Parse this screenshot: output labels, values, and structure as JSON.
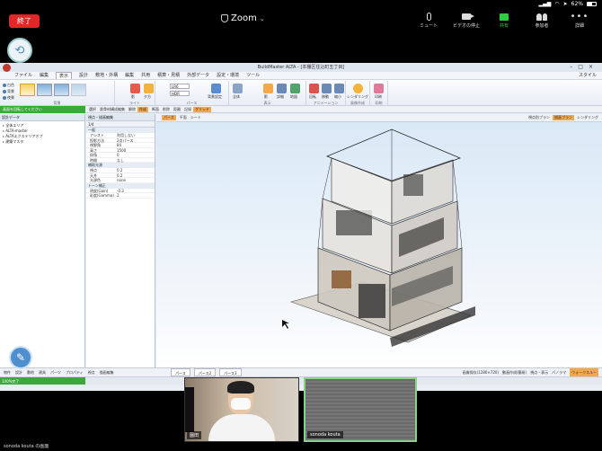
{
  "status_bar": {
    "battery": "62%"
  },
  "zoom": {
    "end_label": "終了",
    "title": "Zoom",
    "tools": [
      {
        "name": "mute",
        "label": "ミュート"
      },
      {
        "name": "video",
        "label": "ビデオの停止"
      },
      {
        "name": "share",
        "label": "共有"
      },
      {
        "name": "participants",
        "label": "参加者"
      },
      {
        "name": "more",
        "label": "詳細"
      }
    ],
    "sharer_text": "sonoda kouta の画面"
  },
  "app": {
    "window_title": "BuildMaster ALTA - [本棚区住込町五丁目]",
    "menu": [
      "ファイル",
      "編集",
      "表示",
      "設計",
      "敷地・外構",
      "編集",
      "共用",
      "積算・見積",
      "外部データ",
      "設定・環境",
      "ツール"
    ],
    "menu_right": "スタイル",
    "ribbon_groups": [
      "背景",
      "ライト",
      "パース",
      "表示",
      "アニメーション",
      "画像作成",
      "印刷"
    ],
    "ribbon_buttons": [
      "影",
      "夕方",
      "背景設定",
      "全体",
      "影",
      "詳細",
      "地図",
      "全面",
      "回転",
      "移動",
      "縮小",
      "レンダリング",
      "印刷"
    ],
    "mini_radios": [
      "白色",
      "背景",
      "夜景"
    ],
    "mini_selects": [
      "LR6",
      "HDR"
    ],
    "subbar_items": [
      "選択",
      "鉄骨材構成編集",
      "解除",
      "作成",
      "断面",
      "削除",
      "距離",
      "記録",
      "グリッド"
    ],
    "subbar_left": "画面を回転してください",
    "left_panel_title": "設計データ",
    "tree_items": [
      "全体エリア",
      "ALTA-master",
      "ALTAエクステリアオプ",
      "建築マスタ"
    ],
    "prop_panel_title": "視点・描画編集",
    "prop_toolbar": "1/4",
    "prop_sections": [
      {
        "title": "一般",
        "rows": [
          {
            "k": "アシスト",
            "v": "利用しない"
          },
          {
            "k": "投影方法",
            "v": "2点パース"
          },
          {
            "k": "視野角",
            "v": "84"
          },
          {
            "k": "高さ",
            "v": "1500"
          },
          {
            "k": "仰角",
            "v": "0"
          },
          {
            "k": "時間",
            "v": "なし"
          }
        ]
      },
      {
        "title": "補助光源",
        "rows": [
          {
            "k": "視点",
            "v": "0.2"
          },
          {
            "k": "天井",
            "v": "0.2"
          },
          {
            "k": "光源色",
            "v": "none"
          }
        ]
      },
      {
        "title": "トーン補正",
        "rows": [
          {
            "k": "明度(Gain)",
            "v": "-0.3"
          },
          {
            "k": "彩度(Gamma)",
            "v": "2"
          }
        ]
      }
    ],
    "viewport_tabs": [
      "パース",
      "平面",
      "シート"
    ],
    "viewport_right": [
      "視点別プラン",
      "描画プラン",
      "レンダリング"
    ],
    "bottom_tabs": [
      "物件",
      "設計",
      "敷地",
      "建具",
      "パーツ",
      "プロパティ",
      "視点",
      "描画編集"
    ],
    "sheet_tabs": [
      "パース",
      "パース2",
      "パース3"
    ],
    "bottom_right": [
      "画像保存(1280×720)",
      "動画作成(簡易)",
      "視点・表示",
      "パノラマ",
      "ウォークスルー"
    ],
    "status_progress": "100%完了"
  },
  "participants": [
    {
      "name": "園田"
    },
    {
      "name": "sonoda kouta"
    }
  ]
}
